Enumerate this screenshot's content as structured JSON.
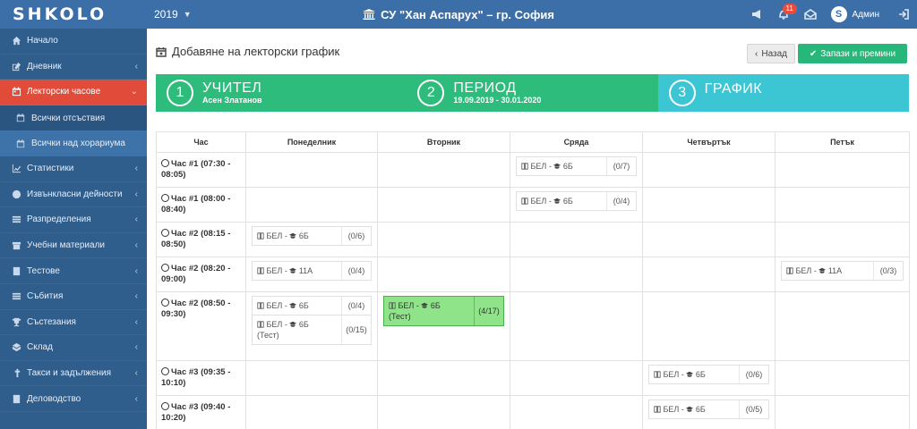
{
  "topbar": {
    "logo": "SHKOLO",
    "year": "2019",
    "school": "СУ \"Хан Аспарух\" – гр. София",
    "notifications_count": "11",
    "user_initial": "S",
    "user_name": "Админ"
  },
  "sidebar": {
    "items": [
      {
        "label": "Начало",
        "icon": "home-icon"
      },
      {
        "label": "Дневник",
        "icon": "edit-icon"
      },
      {
        "label": "Лекторски часове",
        "icon": "calendar-icon"
      },
      {
        "label": "Статистики",
        "icon": "chart-icon"
      },
      {
        "label": "Извънкласни дейности",
        "icon": "ball-icon"
      },
      {
        "label": "Разпределения",
        "icon": "list-icon"
      },
      {
        "label": "Учебни материали",
        "icon": "box-icon"
      },
      {
        "label": "Тестове",
        "icon": "test-icon"
      },
      {
        "label": "Събития",
        "icon": "events-icon"
      },
      {
        "label": "Състезания",
        "icon": "trophy-icon"
      },
      {
        "label": "Склад",
        "icon": "warehouse-icon"
      },
      {
        "label": "Такси и задължения",
        "icon": "coins-icon"
      },
      {
        "label": "Деловодство",
        "icon": "archive-icon"
      }
    ],
    "sub_items": [
      {
        "label": "Всички отсъствия"
      },
      {
        "label": "Всички над хорариума"
      }
    ]
  },
  "page": {
    "title": "Добавяне на лекторски график",
    "back_label": "Назад",
    "save_label": "Запази и премини"
  },
  "wizard": {
    "steps": [
      {
        "num": "1",
        "title": "УЧИТЕЛ",
        "sub": "Асен Златанов"
      },
      {
        "num": "2",
        "title": "ПЕРИОД",
        "sub": "19.09.2019 - 30.01.2020"
      },
      {
        "num": "3",
        "title": "ГРАФИК",
        "sub": ""
      }
    ]
  },
  "table": {
    "headers": [
      "Час",
      "Понеделник",
      "Вторник",
      "Сряда",
      "Четвъртък",
      "Петък"
    ],
    "rows": [
      {
        "time": "Час #1 (07:30 - 08:05)",
        "cells": [
          [],
          [],
          [
            {
              "text": "БЕЛ - 6Б",
              "count": "(0/7)"
            }
          ],
          [],
          []
        ]
      },
      {
        "time": "Час #1 (08:00 - 08:40)",
        "cells": [
          [],
          [],
          [
            {
              "text": "БЕЛ - 6Б",
              "count": "(0/4)"
            }
          ],
          [],
          []
        ]
      },
      {
        "time": "Час #2 (08:15 - 08:50)",
        "cells": [
          [
            {
              "text": "БЕЛ - 6Б",
              "count": "(0/6)"
            }
          ],
          [],
          [],
          [],
          []
        ]
      },
      {
        "time": "Час #2 (08:20 - 09:00)",
        "cells": [
          [
            {
              "text": "БЕЛ - 11А",
              "count": "(0/4)"
            }
          ],
          [],
          [],
          [],
          [
            {
              "text": "БЕЛ - 11А",
              "count": "(0/3)"
            }
          ]
        ]
      },
      {
        "time": "Час #2 (08:50 - 09:30)",
        "cells": [
          [
            {
              "text": "БЕЛ - 6Б",
              "count": "(0/4)"
            },
            {
              "text": "БЕЛ - 6Б",
              "note": "(Тест)",
              "count": "(0/15)"
            }
          ],
          [
            {
              "text": "БЕЛ - 6Б",
              "note": "(Тест)",
              "count": "(4/17)",
              "highlight": true
            }
          ],
          [],
          [],
          []
        ]
      },
      {
        "time": "Час #3 (09:35 - 10:10)",
        "cells": [
          [],
          [],
          [],
          [
            {
              "text": "БЕЛ - 6Б",
              "count": "(0/6)"
            }
          ],
          []
        ]
      },
      {
        "time": "Час #3 (09:40 - 10:20)",
        "cells": [
          [],
          [],
          [],
          [
            {
              "text": "БЕЛ - 6Б",
              "count": "(0/5)"
            }
          ],
          []
        ]
      }
    ]
  },
  "colors": {
    "topbar": "#3c6fa8",
    "sidebar": "#2f5d8c",
    "active": "#e04b3a",
    "green": "#2ebc7c",
    "cyan": "#3cc6d4",
    "highlight": "#8fe48a"
  }
}
